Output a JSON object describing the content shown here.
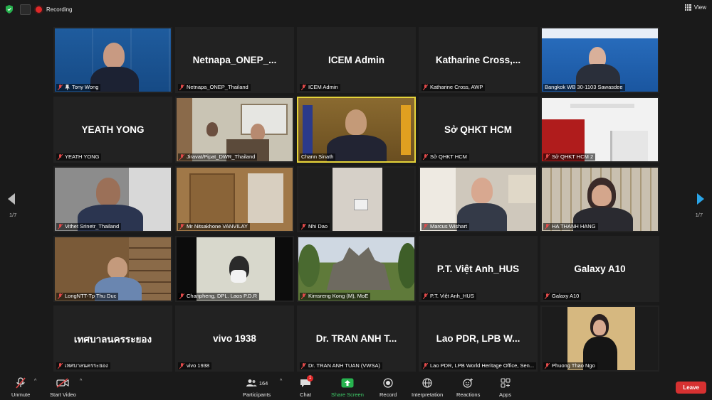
{
  "topbar": {
    "recording": "Recording",
    "view": "View"
  },
  "pages": {
    "left": "1/7",
    "right": "1/7"
  },
  "tiles": [
    {
      "label": "Tony Wong",
      "big": ""
    },
    {
      "label": "Netnapa_ONEP_Thailand",
      "big": "Netnapa_ONEP_..."
    },
    {
      "label": "ICEM Admin",
      "big": "ICEM Admin"
    },
    {
      "label": "Katharine Cross, AWP",
      "big": "Katharine  Cross,..."
    },
    {
      "label": "Bangkok WB 30-1103 Sawasdee",
      "big": ""
    },
    {
      "label": "YEATH YONG",
      "big": "YEATH YONG"
    },
    {
      "label": "Jiravat/Pipat_DWR_Thailand",
      "big": ""
    },
    {
      "label": "Chann Sinath",
      "big": ""
    },
    {
      "label": "Sở QHKT HCM",
      "big": "Sở QHKT HCM"
    },
    {
      "label": "Sở QHKT HCM 2",
      "big": ""
    },
    {
      "label": "Vithet Srinetr_Thailand",
      "big": ""
    },
    {
      "label": "Mr Nitsakhone VANVILAY",
      "big": ""
    },
    {
      "label": "Nhi Dao",
      "big": ""
    },
    {
      "label": "Marcus Wishart",
      "big": ""
    },
    {
      "label": "HA THANH HANG",
      "big": ""
    },
    {
      "label": "LongNTT-Tp Thu Duc",
      "big": ""
    },
    {
      "label": "Chanpheng,  DPL. Laos P.D.R",
      "big": ""
    },
    {
      "label": "Kimsreng Kong (M), MoE",
      "big": ""
    },
    {
      "label": "P.T. Việt Anh_HUS",
      "big": "P.T. Việt Anh_HUS"
    },
    {
      "label": "Galaxy A10",
      "big": "Galaxy A10"
    },
    {
      "label": "เทศบาลนครระยอง",
      "big": "เทศบาลนครระยอง"
    },
    {
      "label": "vivo 1938",
      "big": "vivo 1938"
    },
    {
      "label": "Dr. TRAN ANH TUAN (VWSA)",
      "big": "Dr. TRAN ANH T..."
    },
    {
      "label": "Lao PDR, LPB World Heritage Office, Sen...",
      "big": "Lao PDR, LPB W..."
    },
    {
      "label": "Phuong Thao Ngo",
      "big": ""
    }
  ],
  "toolbar": {
    "unmute": "Unmute",
    "start_video": "Start Video",
    "participants": "Participants",
    "participants_count": "164",
    "chat": "Chat",
    "chat_badge": "1",
    "share": "Share Screen",
    "record": "Record",
    "interpretation": "Interpretation",
    "reactions": "Reactions",
    "apps": "Apps",
    "leave": "Leave"
  },
  "colors": {
    "active_speaker": "#e5d43a",
    "share": "#3fcf6a",
    "leave": "#d63131"
  }
}
